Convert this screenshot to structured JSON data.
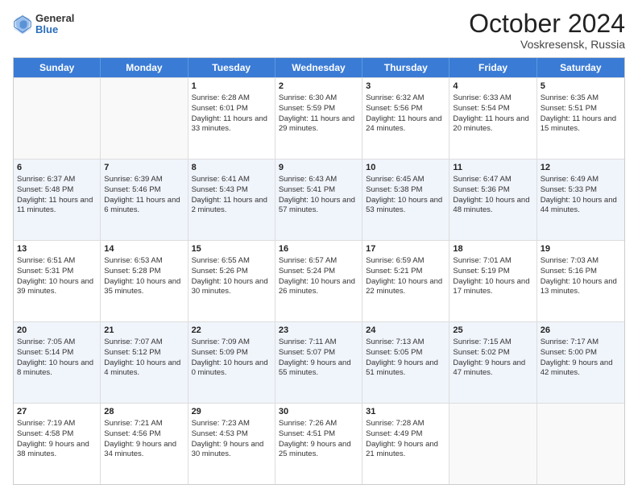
{
  "header": {
    "logo": {
      "general": "General",
      "blue": "Blue"
    },
    "month": "October 2024",
    "location": "Voskresensk, Russia"
  },
  "days": [
    "Sunday",
    "Monday",
    "Tuesday",
    "Wednesday",
    "Thursday",
    "Friday",
    "Saturday"
  ],
  "weeks": [
    [
      {
        "day": "",
        "sunrise": "",
        "sunset": "",
        "daylight": "",
        "empty": true
      },
      {
        "day": "",
        "sunrise": "",
        "sunset": "",
        "daylight": "",
        "empty": true
      },
      {
        "day": "1",
        "sunrise": "Sunrise: 6:28 AM",
        "sunset": "Sunset: 6:01 PM",
        "daylight": "Daylight: 11 hours and 33 minutes."
      },
      {
        "day": "2",
        "sunrise": "Sunrise: 6:30 AM",
        "sunset": "Sunset: 5:59 PM",
        "daylight": "Daylight: 11 hours and 29 minutes."
      },
      {
        "day": "3",
        "sunrise": "Sunrise: 6:32 AM",
        "sunset": "Sunset: 5:56 PM",
        "daylight": "Daylight: 11 hours and 24 minutes."
      },
      {
        "day": "4",
        "sunrise": "Sunrise: 6:33 AM",
        "sunset": "Sunset: 5:54 PM",
        "daylight": "Daylight: 11 hours and 20 minutes."
      },
      {
        "day": "5",
        "sunrise": "Sunrise: 6:35 AM",
        "sunset": "Sunset: 5:51 PM",
        "daylight": "Daylight: 11 hours and 15 minutes."
      }
    ],
    [
      {
        "day": "6",
        "sunrise": "Sunrise: 6:37 AM",
        "sunset": "Sunset: 5:48 PM",
        "daylight": "Daylight: 11 hours and 11 minutes."
      },
      {
        "day": "7",
        "sunrise": "Sunrise: 6:39 AM",
        "sunset": "Sunset: 5:46 PM",
        "daylight": "Daylight: 11 hours and 6 minutes."
      },
      {
        "day": "8",
        "sunrise": "Sunrise: 6:41 AM",
        "sunset": "Sunset: 5:43 PM",
        "daylight": "Daylight: 11 hours and 2 minutes."
      },
      {
        "day": "9",
        "sunrise": "Sunrise: 6:43 AM",
        "sunset": "Sunset: 5:41 PM",
        "daylight": "Daylight: 10 hours and 57 minutes."
      },
      {
        "day": "10",
        "sunrise": "Sunrise: 6:45 AM",
        "sunset": "Sunset: 5:38 PM",
        "daylight": "Daylight: 10 hours and 53 minutes."
      },
      {
        "day": "11",
        "sunrise": "Sunrise: 6:47 AM",
        "sunset": "Sunset: 5:36 PM",
        "daylight": "Daylight: 10 hours and 48 minutes."
      },
      {
        "day": "12",
        "sunrise": "Sunrise: 6:49 AM",
        "sunset": "Sunset: 5:33 PM",
        "daylight": "Daylight: 10 hours and 44 minutes."
      }
    ],
    [
      {
        "day": "13",
        "sunrise": "Sunrise: 6:51 AM",
        "sunset": "Sunset: 5:31 PM",
        "daylight": "Daylight: 10 hours and 39 minutes."
      },
      {
        "day": "14",
        "sunrise": "Sunrise: 6:53 AM",
        "sunset": "Sunset: 5:28 PM",
        "daylight": "Daylight: 10 hours and 35 minutes."
      },
      {
        "day": "15",
        "sunrise": "Sunrise: 6:55 AM",
        "sunset": "Sunset: 5:26 PM",
        "daylight": "Daylight: 10 hours and 30 minutes."
      },
      {
        "day": "16",
        "sunrise": "Sunrise: 6:57 AM",
        "sunset": "Sunset: 5:24 PM",
        "daylight": "Daylight: 10 hours and 26 minutes."
      },
      {
        "day": "17",
        "sunrise": "Sunrise: 6:59 AM",
        "sunset": "Sunset: 5:21 PM",
        "daylight": "Daylight: 10 hours and 22 minutes."
      },
      {
        "day": "18",
        "sunrise": "Sunrise: 7:01 AM",
        "sunset": "Sunset: 5:19 PM",
        "daylight": "Daylight: 10 hours and 17 minutes."
      },
      {
        "day": "19",
        "sunrise": "Sunrise: 7:03 AM",
        "sunset": "Sunset: 5:16 PM",
        "daylight": "Daylight: 10 hours and 13 minutes."
      }
    ],
    [
      {
        "day": "20",
        "sunrise": "Sunrise: 7:05 AM",
        "sunset": "Sunset: 5:14 PM",
        "daylight": "Daylight: 10 hours and 8 minutes."
      },
      {
        "day": "21",
        "sunrise": "Sunrise: 7:07 AM",
        "sunset": "Sunset: 5:12 PM",
        "daylight": "Daylight: 10 hours and 4 minutes."
      },
      {
        "day": "22",
        "sunrise": "Sunrise: 7:09 AM",
        "sunset": "Sunset: 5:09 PM",
        "daylight": "Daylight: 10 hours and 0 minutes."
      },
      {
        "day": "23",
        "sunrise": "Sunrise: 7:11 AM",
        "sunset": "Sunset: 5:07 PM",
        "daylight": "Daylight: 9 hours and 55 minutes."
      },
      {
        "day": "24",
        "sunrise": "Sunrise: 7:13 AM",
        "sunset": "Sunset: 5:05 PM",
        "daylight": "Daylight: 9 hours and 51 minutes."
      },
      {
        "day": "25",
        "sunrise": "Sunrise: 7:15 AM",
        "sunset": "Sunset: 5:02 PM",
        "daylight": "Daylight: 9 hours and 47 minutes."
      },
      {
        "day": "26",
        "sunrise": "Sunrise: 7:17 AM",
        "sunset": "Sunset: 5:00 PM",
        "daylight": "Daylight: 9 hours and 42 minutes."
      }
    ],
    [
      {
        "day": "27",
        "sunrise": "Sunrise: 7:19 AM",
        "sunset": "Sunset: 4:58 PM",
        "daylight": "Daylight: 9 hours and 38 minutes."
      },
      {
        "day": "28",
        "sunrise": "Sunrise: 7:21 AM",
        "sunset": "Sunset: 4:56 PM",
        "daylight": "Daylight: 9 hours and 34 minutes."
      },
      {
        "day": "29",
        "sunrise": "Sunrise: 7:23 AM",
        "sunset": "Sunset: 4:53 PM",
        "daylight": "Daylight: 9 hours and 30 minutes."
      },
      {
        "day": "30",
        "sunrise": "Sunrise: 7:26 AM",
        "sunset": "Sunset: 4:51 PM",
        "daylight": "Daylight: 9 hours and 25 minutes."
      },
      {
        "day": "31",
        "sunrise": "Sunrise: 7:28 AM",
        "sunset": "Sunset: 4:49 PM",
        "daylight": "Daylight: 9 hours and 21 minutes."
      },
      {
        "day": "",
        "sunrise": "",
        "sunset": "",
        "daylight": "",
        "empty": true
      },
      {
        "day": "",
        "sunrise": "",
        "sunset": "",
        "daylight": "",
        "empty": true
      }
    ]
  ]
}
